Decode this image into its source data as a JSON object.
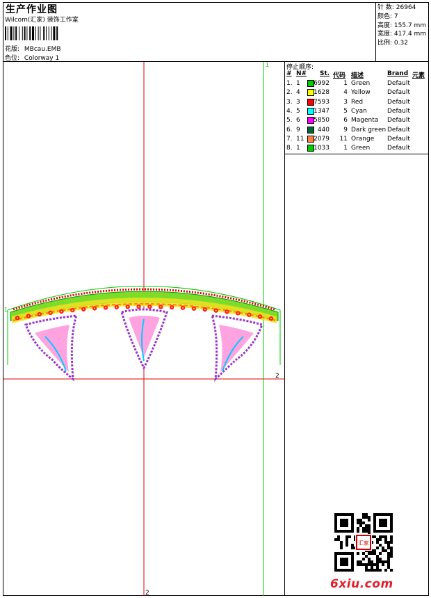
{
  "header": {
    "title": "生产作业图",
    "subtitle": "Wilcom(汇家) 装饰工作室",
    "design_label": "花版:",
    "design_value": "MBcau.EMB",
    "colorway_label": "色位:",
    "colorway_value": "Colorway 1"
  },
  "stats": {
    "stitches_label": "针 数:",
    "stitches_value": "26964",
    "colors_label": "颜色:",
    "colors_value": "7",
    "height_label": "高度:",
    "height_value": "155.7 mm",
    "width_label": "宽度:",
    "width_value": "417.4 mm",
    "scale_label": "比例:",
    "scale_value": "0.32"
  },
  "stop_sequence": {
    "title": "停止顺序:",
    "headers": {
      "num": "#",
      "no": "N#",
      "st": "St.",
      "code": "代码",
      "desc": "描述",
      "brand": "Brand",
      "element": "元素"
    },
    "rows": [
      {
        "num": "1.",
        "no": "1",
        "st": "6992",
        "code": "1",
        "desc": "Green",
        "brand": "Default",
        "color": "#00cc00"
      },
      {
        "num": "2.",
        "no": "4",
        "st": "1628",
        "code": "4",
        "desc": "Yellow",
        "brand": "Default",
        "color": "#ffff00"
      },
      {
        "num": "3.",
        "no": "3",
        "st": "7593",
        "code": "3",
        "desc": "Red",
        "brand": "Default",
        "color": "#ff0000"
      },
      {
        "num": "4.",
        "no": "5",
        "st": "1347",
        "code": "5",
        "desc": "Cyan",
        "brand": "Default",
        "color": "#00ffff"
      },
      {
        "num": "5.",
        "no": "6",
        "st": "5850",
        "code": "6",
        "desc": "Magenta",
        "brand": "Default",
        "color": "#ff00ff"
      },
      {
        "num": "6.",
        "no": "9",
        "st": "440",
        "code": "9",
        "desc": "Dark green",
        "brand": "Default",
        "color": "#006633"
      },
      {
        "num": "7.",
        "no": "11",
        "st": "2079",
        "code": "11",
        "desc": "Orange",
        "brand": "Default",
        "color": "#ff8040"
      },
      {
        "num": "8.",
        "no": "1",
        "st": "1033",
        "code": "1",
        "desc": "Green",
        "brand": "Default",
        "color": "#00cc00"
      }
    ]
  },
  "guides": {
    "v_red_label": "2",
    "h_red_label": "2",
    "v_green_label": "1",
    "h_green_label": "1"
  },
  "watermark": {
    "site": "6xiu.com",
    "stamp_text": "汇家"
  },
  "colors": {
    "guide_red": "#e00000",
    "guide_green": "#00c800",
    "brand_red": "#e0202c"
  }
}
